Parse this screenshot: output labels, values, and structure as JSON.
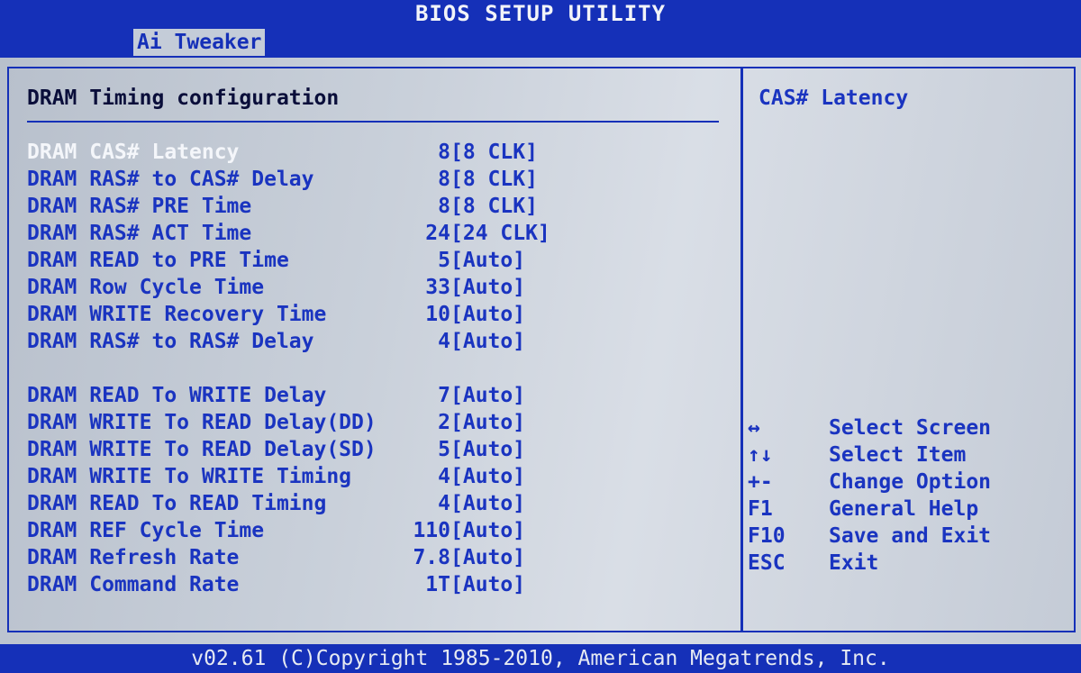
{
  "title": "BIOS SETUP UTILITY",
  "tabs": [
    {
      "label": "Ai Tweaker",
      "active": true
    }
  ],
  "section_title": "DRAM Timing configuration",
  "settings": [
    {
      "label": "DRAM CAS# Latency",
      "value": "8",
      "option": "[8 CLK]",
      "selected": true
    },
    {
      "label": "DRAM RAS# to CAS# Delay",
      "value": "8",
      "option": "[8 CLK]"
    },
    {
      "label": "DRAM RAS# PRE Time",
      "value": "8",
      "option": "[8 CLK]"
    },
    {
      "label": "DRAM RAS# ACT Time",
      "value": "24",
      "option": "[24 CLK]"
    },
    {
      "label": "DRAM READ to PRE Time",
      "value": "5",
      "option": "[Auto]"
    },
    {
      "label": "DRAM Row Cycle Time",
      "value": "33",
      "option": "[Auto]"
    },
    {
      "label": "DRAM WRITE Recovery Time",
      "value": "10",
      "option": "[Auto]"
    },
    {
      "label": "DRAM RAS# to RAS# Delay",
      "value": "4",
      "option": "[Auto]"
    },
    {
      "label": "DRAM READ To WRITE Delay",
      "value": "7",
      "option": "[Auto]"
    },
    {
      "label": "DRAM WRITE To READ Delay(DD)",
      "value": "2",
      "option": "[Auto]"
    },
    {
      "label": "DRAM WRITE To READ Delay(SD)",
      "value": "5",
      "option": "[Auto]"
    },
    {
      "label": "DRAM WRITE To WRITE Timing",
      "value": "4",
      "option": "[Auto]"
    },
    {
      "label": "DRAM READ To READ Timing",
      "value": "4",
      "option": "[Auto]"
    },
    {
      "label": "DRAM REF Cycle Time",
      "value": "110",
      "option": "[Auto]"
    },
    {
      "label": "DRAM Refresh Rate",
      "value": "7.8",
      "option": "[Auto]"
    },
    {
      "label": "DRAM Command Rate",
      "value": "1T",
      "option": "[Auto]"
    }
  ],
  "help": {
    "title": "CAS# Latency"
  },
  "keys": [
    {
      "key": "↔",
      "desc": "Select Screen"
    },
    {
      "key": "↑↓",
      "desc": "Select Item"
    },
    {
      "key": "+-",
      "desc": "Change Option"
    },
    {
      "key": "F1",
      "desc": "General Help"
    },
    {
      "key": "F10",
      "desc": "Save and Exit"
    },
    {
      "key": "ESC",
      "desc": "Exit"
    }
  ],
  "footer": "v02.61 (C)Copyright 1985-2010, American Megatrends, Inc.",
  "colors": {
    "bios_blue": "#1530b8",
    "panel_gray": "#c9d0da",
    "highlight_white": "#f4f6fa"
  }
}
